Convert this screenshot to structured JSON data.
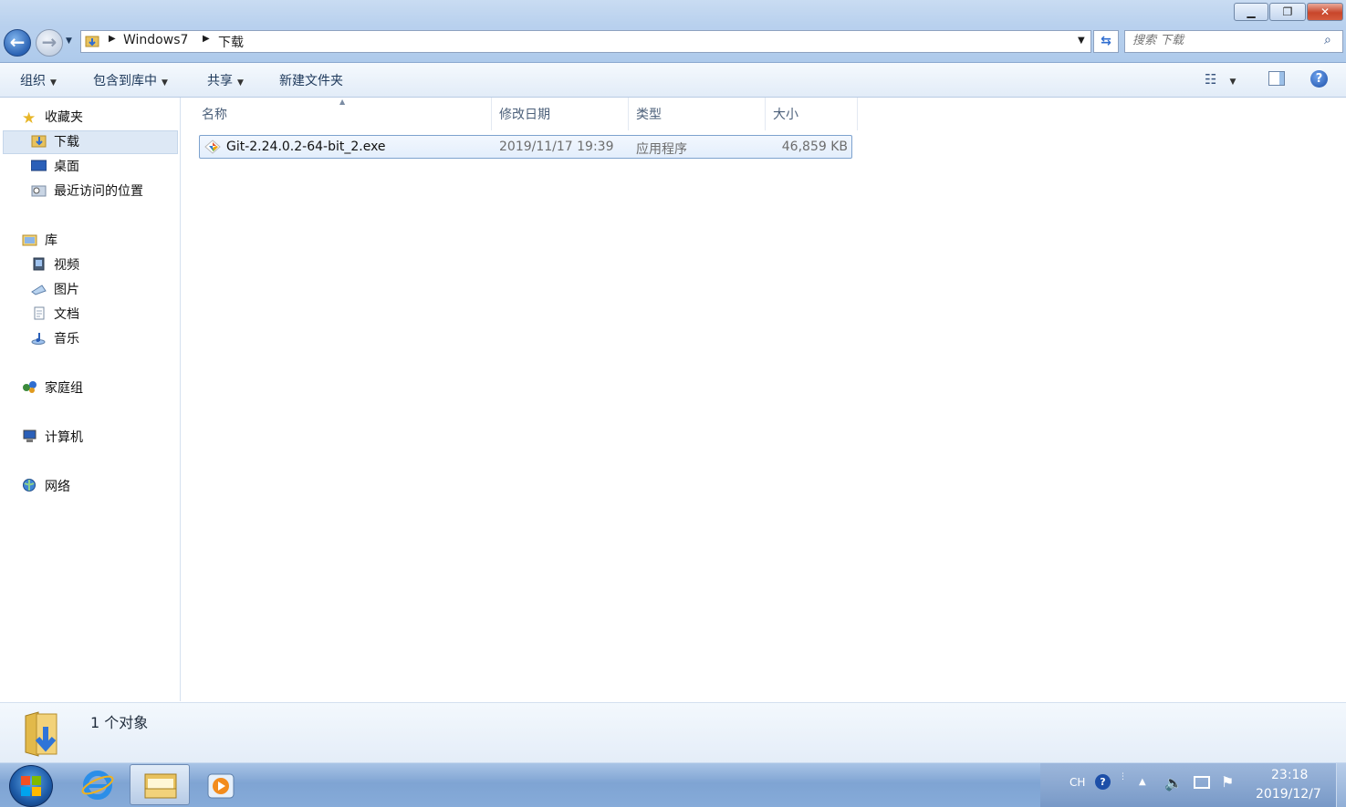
{
  "window": {
    "minimize_label": "▁",
    "maximize_label": "❐",
    "close_label": "✕"
  },
  "address": {
    "segments": [
      "Windows7",
      "下载"
    ],
    "refresh_icon": "refresh-icon"
  },
  "search": {
    "placeholder": "搜索 下载",
    "icon": "search-icon"
  },
  "toolbar": {
    "organize": "组织",
    "include_in_library": "包含到库中",
    "share": "共享",
    "new_folder": "新建文件夹"
  },
  "sidebar": {
    "favorites": {
      "label": "收藏夹",
      "items": [
        {
          "label": "下载",
          "icon": "downloads-icon",
          "selected": true
        },
        {
          "label": "桌面",
          "icon": "desktop-icon"
        },
        {
          "label": "最近访问的位置",
          "icon": "recent-places-icon"
        }
      ]
    },
    "libraries": {
      "label": "库",
      "items": [
        {
          "label": "视频",
          "icon": "videos-icon"
        },
        {
          "label": "图片",
          "icon": "pictures-icon"
        },
        {
          "label": "文档",
          "icon": "documents-icon"
        },
        {
          "label": "音乐",
          "icon": "music-icon"
        }
      ]
    },
    "homegroup": "家庭组",
    "computer": "计算机",
    "network": "网络"
  },
  "columns": {
    "name": "名称",
    "modified": "修改日期",
    "type": "类型",
    "size": "大小"
  },
  "files": [
    {
      "name": "Git-2.24.0.2-64-bit_2.exe",
      "modified": "2019/11/17 19:39",
      "type": "应用程序",
      "size": "46,859 KB"
    }
  ],
  "details": {
    "count_text": "1 个对象"
  },
  "taskbar": {
    "language": "CH",
    "time": "23:18",
    "date": "2019/12/7"
  },
  "colors": {
    "accent": "#3d7bd9",
    "selection": "#dde8f5"
  }
}
